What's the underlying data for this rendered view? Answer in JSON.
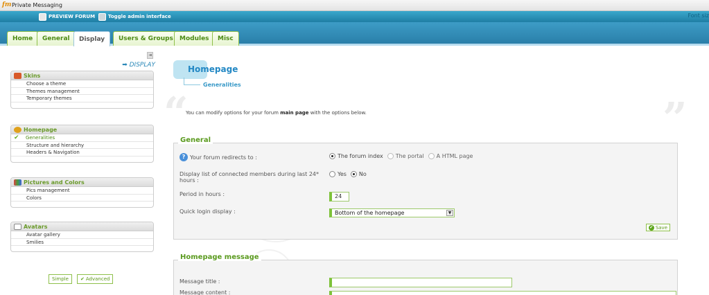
{
  "window": {
    "title": "Private Messaging",
    "logo": "fm"
  },
  "adminbar": {
    "preview_label": "PREVIEW FORUM",
    "toggle_label": "Toggle admin interface",
    "font_size_label": "Font siz"
  },
  "tabs": [
    {
      "label": "Home"
    },
    {
      "label": "General"
    },
    {
      "label": "Display",
      "active": true
    },
    {
      "label": "Users & Groups"
    },
    {
      "label": "Modules"
    },
    {
      "label": "Misc"
    }
  ],
  "sidebar": {
    "section_title": "➡ DISPLAY",
    "collapse_icon": "◄",
    "menus": [
      {
        "title": "Skins",
        "icon": "palette-icon",
        "items": [
          {
            "label": "Choose a theme"
          },
          {
            "label": "Themes management"
          },
          {
            "label": "Temporary themes"
          }
        ]
      },
      {
        "title": "Homepage",
        "icon": "homepage-icon",
        "items": [
          {
            "label": "Generalities",
            "selected": true
          },
          {
            "label": "Structure and hierarchy"
          },
          {
            "label": "Headers & Navigation"
          }
        ]
      },
      {
        "title": "Pictures and Colors",
        "icon": "pictures-icon",
        "items": [
          {
            "label": "Pics management"
          },
          {
            "label": "Colors"
          }
        ]
      },
      {
        "title": "Avatars",
        "icon": "avatar-icon",
        "items": [
          {
            "label": "Avatar gallery"
          },
          {
            "label": "Smilies"
          }
        ]
      }
    ],
    "mode_simple": "Simple",
    "mode_advanced": "Advanced"
  },
  "main": {
    "page_title": "Homepage",
    "subtitle": "Generalities",
    "intro_before": "You can modify options for your forum ",
    "intro_bold": "main page",
    "intro_after": " with the options below.",
    "general": {
      "legend": "General",
      "redirect_label": "Your forum redirects to :",
      "redirect_options": [
        {
          "label": "The forum index",
          "checked": true
        },
        {
          "label": "The portal",
          "checked": false
        },
        {
          "label": "A HTML page",
          "checked": false
        }
      ],
      "connected_label": "Display list of connected members during last 24* hours :",
      "connected_options": [
        {
          "label": "Yes",
          "checked": false
        },
        {
          "label": "No",
          "checked": true
        }
      ],
      "period_label": "Period in hours :",
      "period_value": "24",
      "quick_login_label": "Quick login display :",
      "quick_login_value": "Bottom of the homepage",
      "save_label": "Save"
    },
    "homepage_message": {
      "legend": "Homepage message",
      "title_label": "Message title :",
      "title_value": "",
      "content_label": "Message content :"
    }
  },
  "colors": {
    "accent_green": "#7ec23a",
    "accent_blue": "#2388c4",
    "bar_blue": "#2a7fa9"
  }
}
